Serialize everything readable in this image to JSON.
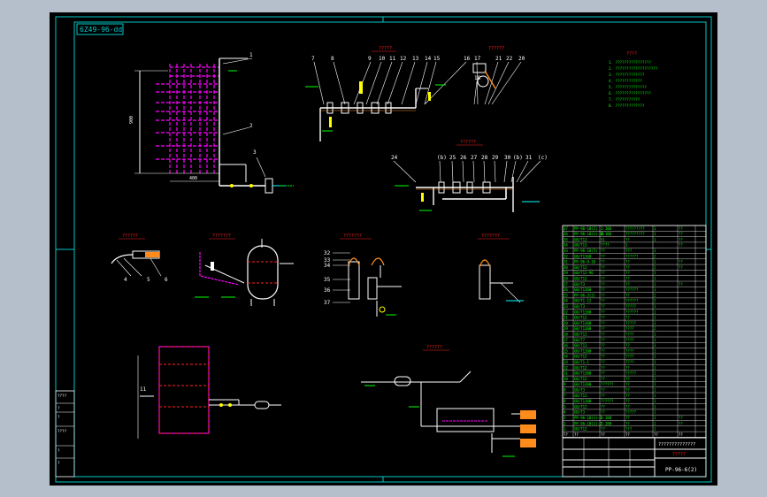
{
  "drawing": {
    "code_box": "6Z49-96-dd",
    "title_cn": "?????",
    "drawing_no": "PP-96-6(2)",
    "company": "??????????????",
    "scale": "1"
  },
  "balloons_top": [
    "7",
    "8",
    "9",
    "10",
    "11",
    "12",
    "13",
    "14",
    "15",
    "16",
    "17",
    "21",
    "22",
    "20",
    "18"
  ],
  "balloons_mid": [
    "24",
    "(b)",
    "25",
    "26",
    "27",
    "28",
    "29",
    "30",
    "(b)",
    "31",
    "(c)"
  ],
  "balloons_left": [
    "1",
    "2",
    "3"
  ],
  "balloons_small": [
    "4",
    "5",
    "6"
  ],
  "balloons_side": [
    "32",
    "33",
    "34",
    "35",
    "36",
    "37"
  ],
  "view_titles": [
    "?????",
    "??????",
    "??????",
    "??????",
    "???????",
    "???????",
    "???????",
    "??????"
  ],
  "dim_labels": [
    "900",
    "400",
    "200",
    "11"
  ],
  "notes_title": "????",
  "notes": [
    "1. ????????????????",
    "2. ???????????????????",
    "3. ?????????????",
    "4. ????????????",
    "5. ??????????????",
    "6. ????????????????",
    "7. ???????????",
    "8. ?????????????"
  ],
  "bom_rows": [
    [
      "37",
      "PP-96-10(2)",
      "I-100",
      "?????????",
      "1",
      "??"
    ],
    [
      "36",
      "PP-96-10(1)-36",
      "I-100",
      "?????????",
      "1",
      "??"
    ],
    [
      "35",
      "GB/T12",
      "S1",
      "??",
      "1",
      "??"
    ],
    [
      "34",
      "GB/T13",
      "????",
      "1",
      "",
      "??"
    ],
    [
      "33",
      "PP-96-10(5)",
      "??",
      "???",
      "1",
      ""
    ],
    [
      "32",
      "GB/T1360",
      "??",
      "??????",
      "2",
      ""
    ],
    [
      "31",
      "PP-96-9-10",
      "??",
      "??",
      "1",
      "??"
    ],
    [
      "30",
      "GB/T12",
      "??",
      "??",
      "2",
      "??"
    ],
    [
      "29",
      "GB/T12-96",
      "??",
      "??",
      "1",
      ""
    ],
    [
      "28",
      "GB/T12",
      "??",
      "??",
      "1",
      ""
    ],
    [
      "27",
      "GB/T3",
      "??",
      "??",
      "1",
      "??"
    ],
    [
      "26",
      "GB/T1360",
      "??",
      "??????",
      "1",
      ""
    ],
    [
      "25",
      "PP-96-3(2)",
      "??",
      "??",
      "2",
      ""
    ],
    [
      "24",
      "GB/T1-12",
      "??",
      "??????",
      "2",
      ""
    ],
    [
      "23",
      "GB/T3",
      "??",
      "?????",
      "1",
      ""
    ],
    [
      "22",
      "GB/T1360",
      "??",
      "??????",
      "1",
      ""
    ],
    [
      "21",
      "GB/T12",
      "??",
      "??",
      "1",
      ""
    ],
    [
      "20",
      "GB/T1360",
      "??",
      "?????",
      "1",
      ""
    ],
    [
      "19",
      "GB/T1360",
      "??",
      "????",
      "2",
      ""
    ],
    [
      "18",
      "GB/T12",
      "??",
      "????",
      "1",
      ""
    ],
    [
      "17",
      "GB/T7",
      "??",
      "????",
      "1",
      ""
    ],
    [
      "16",
      "GB/T12",
      "??",
      "??",
      "1",
      ""
    ],
    [
      "15",
      "GB/T1360",
      "??",
      "????",
      "1",
      ""
    ],
    [
      "14",
      "GB/T12",
      "??",
      "????",
      "1",
      ""
    ],
    [
      "13",
      "GB/T1-1",
      "??",
      "????",
      "1",
      ""
    ],
    [
      "12",
      "GB/T12",
      "??",
      "??",
      "1",
      ""
    ],
    [
      "11",
      "GB/T1360",
      "??",
      "?????",
      "1",
      ""
    ],
    [
      "10",
      "GB/T12",
      "??",
      "??",
      "1",
      ""
    ],
    [
      "9",
      "GB/T1360",
      "??????",
      "??",
      "1",
      ""
    ],
    [
      "8",
      "GB/T3",
      "??",
      "??",
      "1",
      ""
    ],
    [
      "7",
      "GB/T12",
      "??",
      "??",
      "1",
      ""
    ],
    [
      "6",
      "GB/T1360",
      "??????",
      "??",
      "1",
      ""
    ],
    [
      "5",
      "GB/T12",
      "??",
      "??",
      "1",
      ""
    ],
    [
      "4",
      "GB/T3",
      "??",
      "?????",
      "1",
      ""
    ],
    [
      "3",
      "PP-96-10(1)-3",
      "I-100",
      "??",
      "1",
      "??"
    ],
    [
      "2",
      "PP-96-10(1)-2",
      "I-100",
      "??",
      "1",
      "??"
    ],
    [
      "1",
      "GB/T12",
      "??",
      "???",
      "1",
      ""
    ]
  ],
  "bom_header": [
    "??",
    "??",
    "??",
    "??",
    "??",
    "??"
  ],
  "left_strip": [
    "????",
    "?",
    "?",
    "????",
    "?",
    "?"
  ],
  "colors": {
    "background": "#000000",
    "frame": "#00c8c8",
    "pipe_white": "#ffffff",
    "magenta": "#ff00ff",
    "yellow": "#ffff00",
    "green": "#00ff00",
    "red": "#ff2020",
    "orange": "#ff8c1a",
    "cyan": "#00ffff",
    "outer_margin": "#b5bfcc"
  }
}
